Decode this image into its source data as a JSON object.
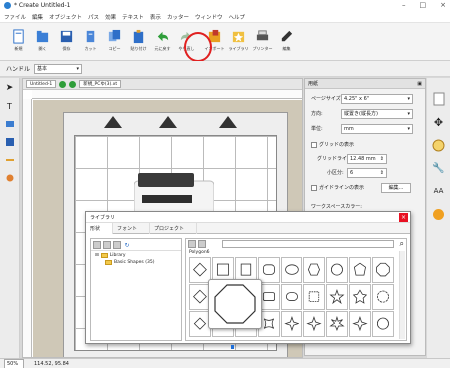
{
  "window": {
    "title": "* Create Untitled-1",
    "controls": [
      "–",
      "□",
      "×"
    ]
  },
  "menu": [
    "ファイル",
    "編集",
    "オブジェクト",
    "パス",
    "効果",
    "テキスト",
    "表示",
    "カッター",
    "ウィンドウ",
    "ヘルプ"
  ],
  "toolbar": {
    "buttons": [
      {
        "label": "新規",
        "icon": "new-document-icon"
      },
      {
        "label": "開く",
        "icon": "open-folder-icon"
      },
      {
        "label": "保存",
        "icon": "save-icon"
      },
      {
        "label": "カット",
        "icon": "cut-icon"
      },
      {
        "label": "コピー",
        "icon": "copy-icon"
      },
      {
        "label": "貼り付け",
        "icon": "paste-icon"
      },
      {
        "label": "元に戻す",
        "icon": "undo-icon"
      },
      {
        "label": "やり直し",
        "icon": "redo-icon"
      },
      {
        "label": "インポート",
        "icon": "import-icon"
      },
      {
        "label": "ライブラリ",
        "icon": "library-icon"
      },
      {
        "label": "プリンター",
        "icon": "printer-icon"
      },
      {
        "label": "編集",
        "icon": "edit-icon"
      }
    ]
  },
  "propbar": {
    "label": "ハンドル",
    "value": "基本"
  },
  "document": {
    "tab": "Untitled-1",
    "tab_title": "新規_PCゆ(3).xt"
  },
  "panel": {
    "title": "用紙",
    "page_size_label": "ページサイズ:",
    "page_size_value": "4.25\" x 6\"",
    "orientation_label": "方向:",
    "orientation_value": "縦置き(縦長方)",
    "units_label": "単位:",
    "units_value": "mm",
    "grid_label": "グリッドの表示",
    "gridline_label": "グリッドライン:",
    "gridline_value": "12.48 mm",
    "subdiv_label": "小区分:",
    "subdiv_value": "6",
    "guides_label": "ガイドラインの表示",
    "guides_button": "編集...",
    "workspace_label": "ワークスペースカラー:"
  },
  "dialog": {
    "title": "ライブラリ",
    "tabs": [
      "形状",
      "フォント",
      "プロジェクト"
    ],
    "tree_root": "Library",
    "tree_child": "Basic Shapes (35)",
    "category": "Polygon6"
  },
  "status": {
    "zoom": "50%",
    "coords": "114.52, 95.84"
  }
}
